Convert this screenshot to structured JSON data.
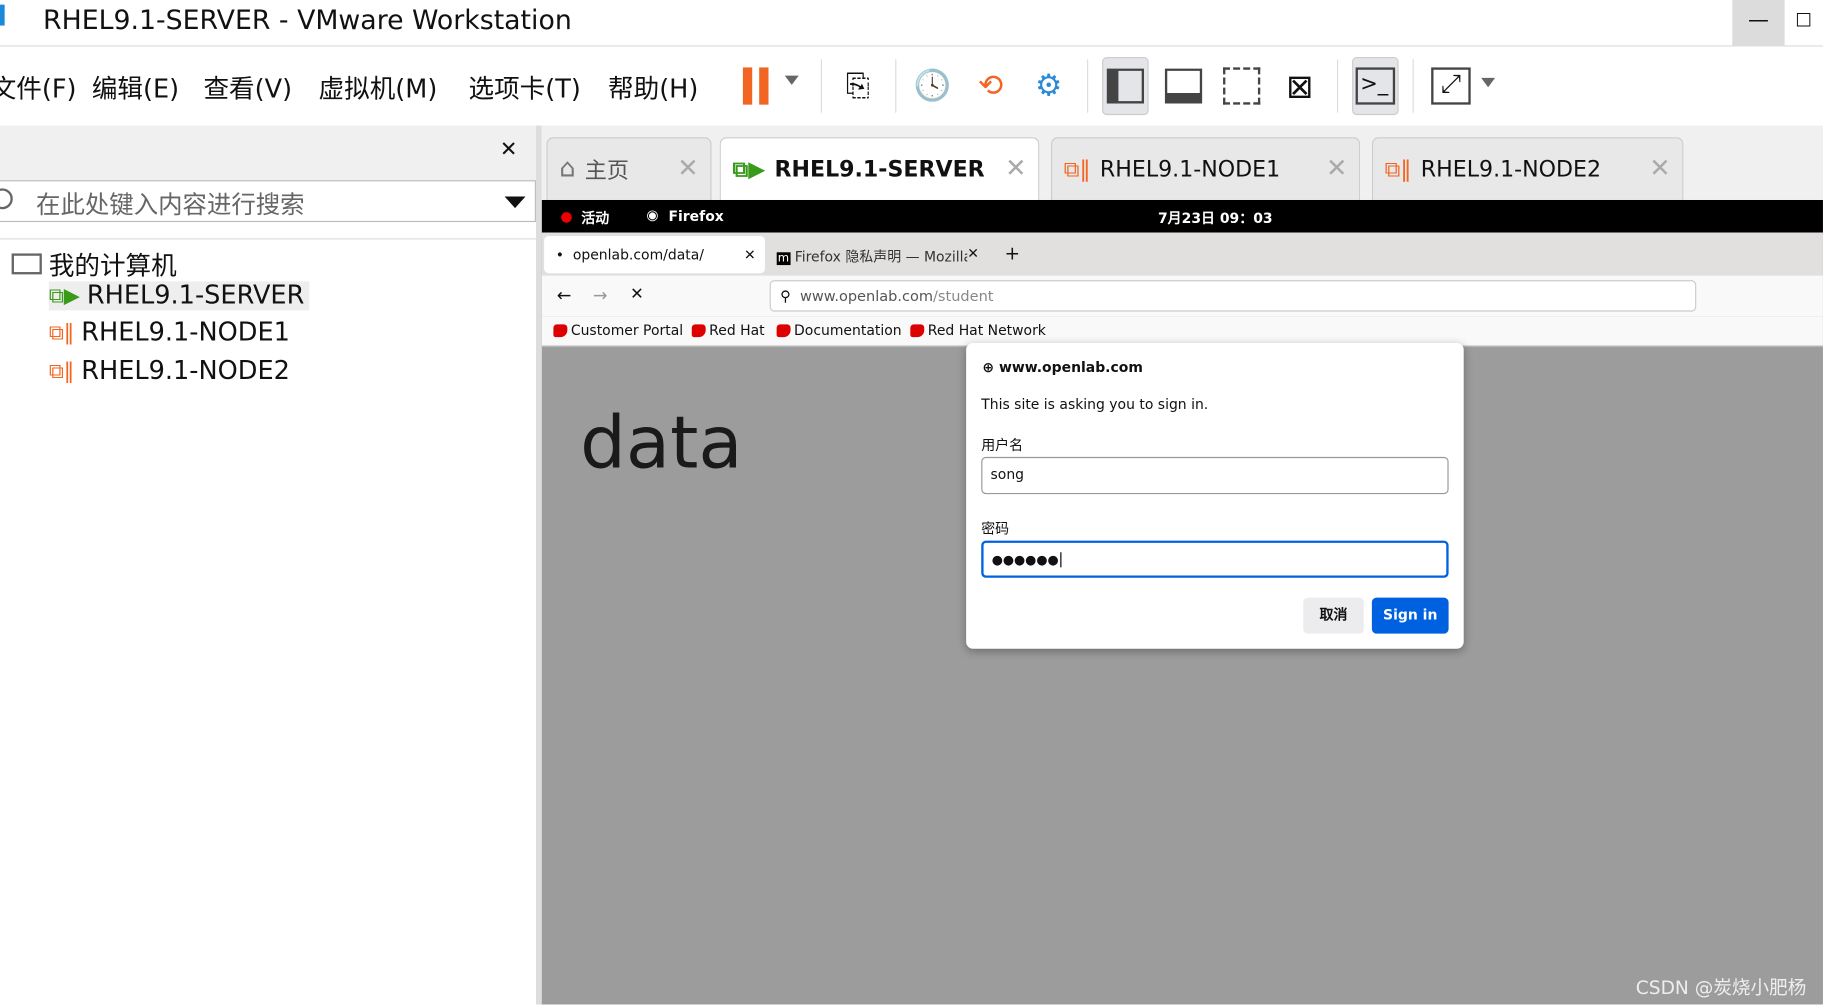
{
  "window": {
    "title": "RHEL9.1-SERVER - VMware Workstation",
    "minimize": "—",
    "maximize": "☐"
  },
  "menu": [
    "文件(F)",
    "编辑(E)",
    "查看(V)",
    "虚拟机(M)",
    "选项卡(T)",
    "帮助(H)"
  ],
  "library": {
    "close": "✕",
    "search_placeholder": "在此处键入内容进行搜索",
    "root": "我的计算机",
    "vms": [
      "RHEL9.1-SERVER",
      "RHEL9.1-NODE1",
      "RHEL9.1-NODE2"
    ]
  },
  "tabs": [
    {
      "label": "主页"
    },
    {
      "label": "RHEL9.1-SERVER"
    },
    {
      "label": "RHEL9.1-NODE1"
    },
    {
      "label": "RHEL9.1-NODE2"
    }
  ],
  "guest": {
    "topbar": {
      "activities": "活动",
      "app": "Firefox",
      "clock": "7月23日  09：03"
    },
    "browser": {
      "tabs": [
        "openlab.com/data/",
        "Firefox 隐私声明 — Mozilla"
      ],
      "url_host": "www.openlab.com",
      "url_path": "/student",
      "bookmarks": [
        "Customer Portal",
        "Red Hat",
        "Documentation",
        "Red Hat Network"
      ],
      "page_text": "data"
    },
    "dialog": {
      "site": "www.openlab.com",
      "message": "This site is asking you to sign in.",
      "username_label": "用户名",
      "username": "song",
      "password_label": "密码",
      "password_mask": "●●●●●●",
      "cancel": "取消",
      "signin": "Sign in"
    }
  },
  "watermark": "CSDN @炭烧小肥杨",
  "colors": {
    "accent": "#0061e0",
    "pause": "#f26522"
  }
}
